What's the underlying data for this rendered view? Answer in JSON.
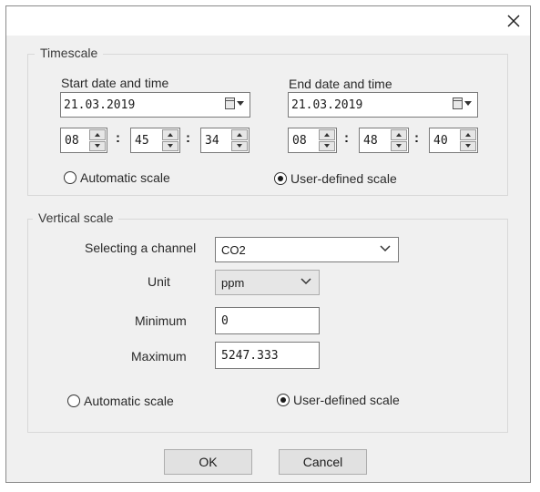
{
  "dialog": {
    "close_label": "×"
  },
  "timescale": {
    "title": "Timescale",
    "start_label": "Start date and time",
    "end_label": "End date and time",
    "start_date": "21.03.2019",
    "end_date": "21.03.2019",
    "start_time": {
      "hh": "08",
      "mm": "45",
      "ss": "34"
    },
    "end_time": {
      "hh": "08",
      "mm": "48",
      "ss": "40"
    },
    "time_sep": ":",
    "auto_label": "Automatic scale",
    "user_label": "User-defined scale",
    "selected": "user"
  },
  "vertical": {
    "title": "Vertical scale",
    "channel_label": "Selecting a channel",
    "channel_value": "CO2",
    "unit_label": "Unit",
    "unit_value": "ppm",
    "min_label": "Minimum",
    "min_value": "0",
    "max_label": "Maximum",
    "max_value": "5247.333",
    "auto_label": "Automatic scale",
    "user_label": "User-defined scale",
    "selected": "user"
  },
  "buttons": {
    "ok": "OK",
    "cancel": "Cancel"
  }
}
